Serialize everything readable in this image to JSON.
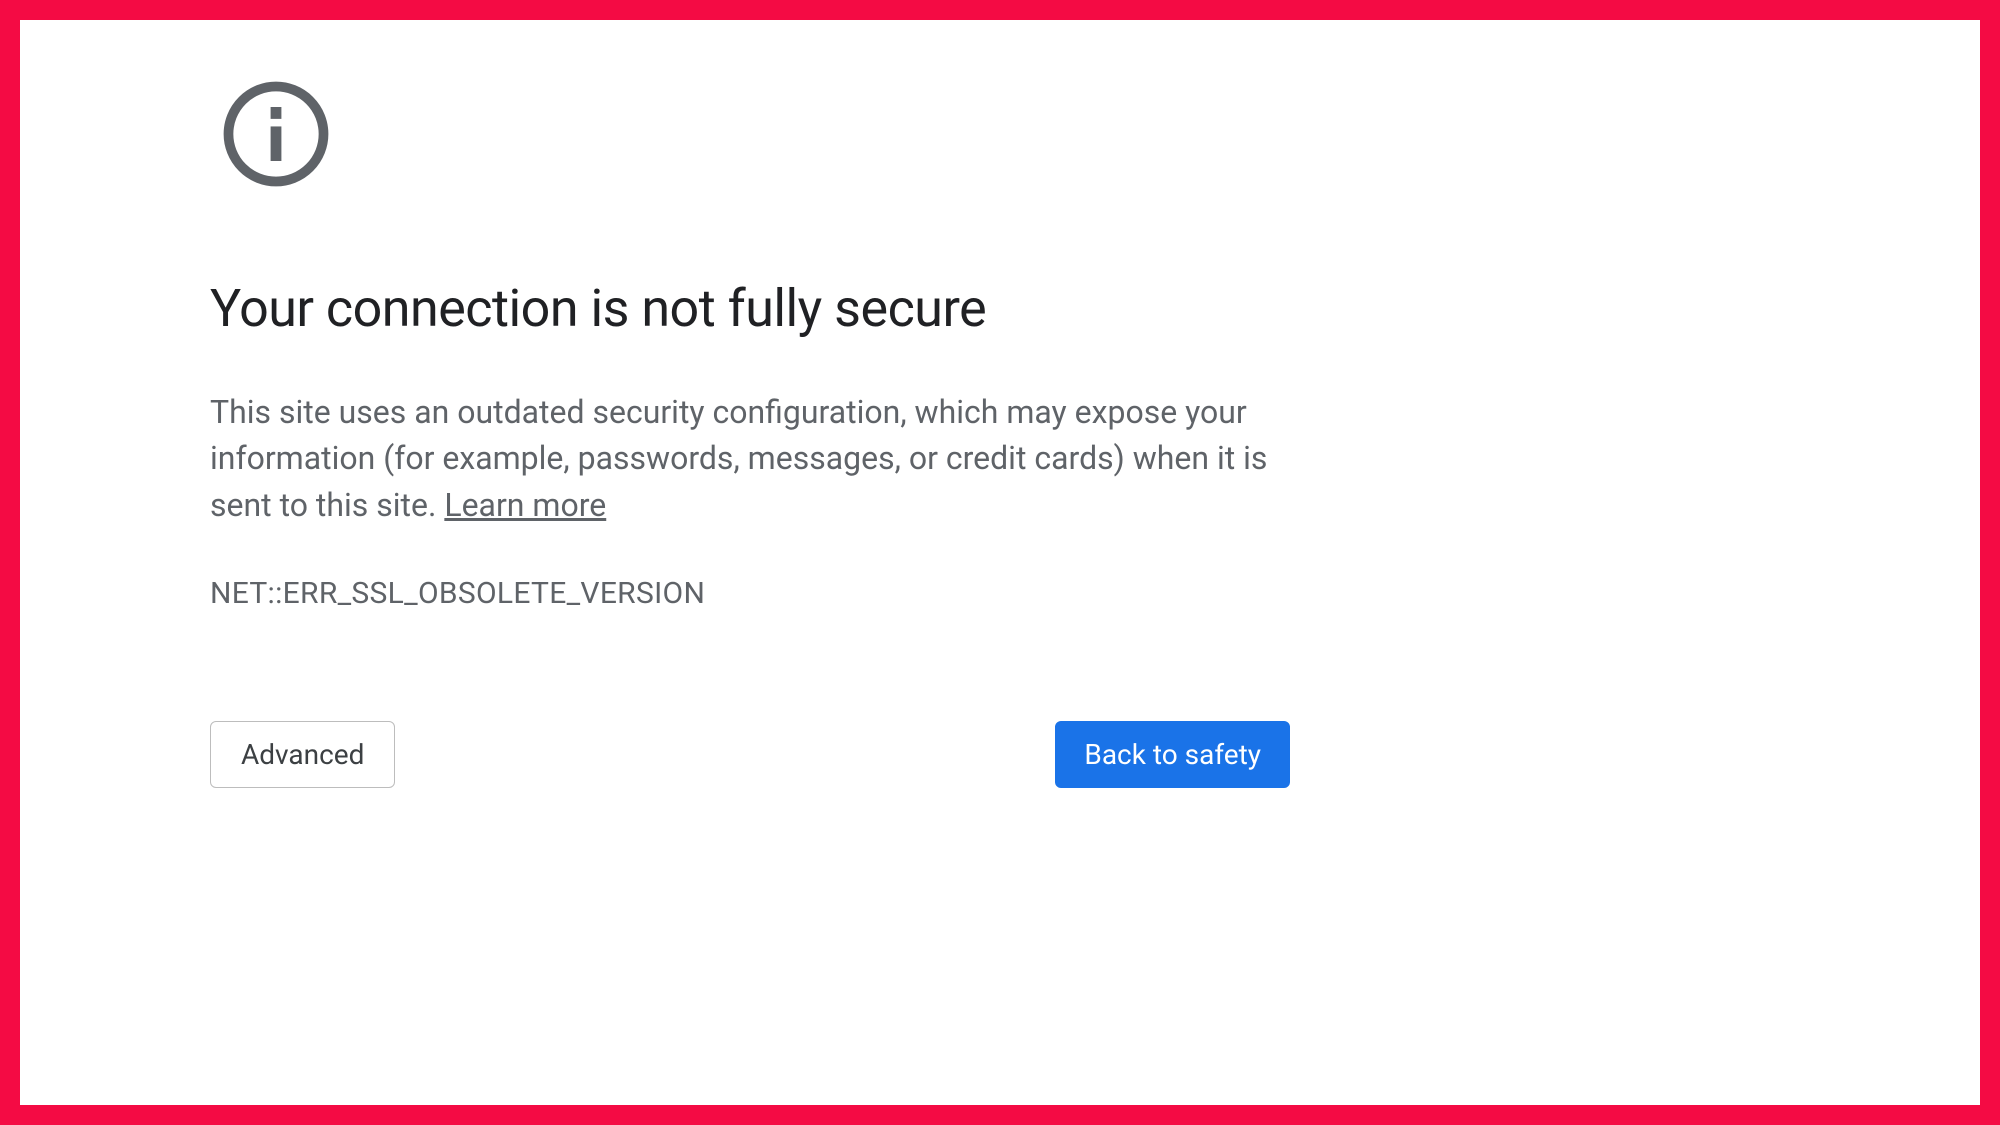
{
  "heading": "Your connection is not fully secure",
  "description_text": "This site uses an outdated security configuration, which may expose your information (for example, passwords, messages, or credit cards) when it is sent to this site. ",
  "learn_more_label": "Learn more",
  "error_code": "NET::ERR_SSL_OBSOLETE_VERSION",
  "buttons": {
    "advanced": "Advanced",
    "back_to_safety": "Back to safety"
  },
  "colors": {
    "border": "#f40b44",
    "primary_button": "#1a73e8",
    "text_muted": "#5f6368",
    "text_heading": "#202124"
  }
}
